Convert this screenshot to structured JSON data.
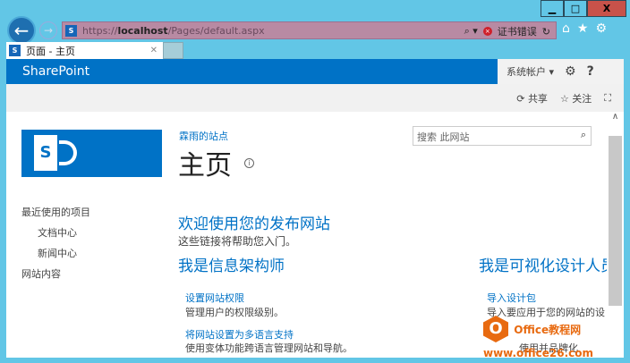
{
  "browser": {
    "url_scheme": "https://",
    "url_host": "localhost",
    "url_path": "/Pages/default.aspx",
    "cert_error": "证书错误",
    "tab_title": "页面 - 主页",
    "window_controls": [
      "minimize",
      "maximize",
      "close"
    ]
  },
  "suite_bar": {
    "brand": "SharePoint",
    "account": "系统帐户",
    "brand_color": "#0072c6"
  },
  "ribbon": {
    "share": "共享",
    "follow": "关注"
  },
  "site": {
    "breadcrumb": "霖雨的站点",
    "title": "主页",
    "search_placeholder": "搜索 此网站"
  },
  "quick_launch": [
    {
      "label": "最近使用的项目",
      "level": 0
    },
    {
      "label": "文档中心",
      "level": 1
    },
    {
      "label": "新闻中心",
      "level": 1
    },
    {
      "label": "网站内容",
      "level": 0
    }
  ],
  "main": {
    "welcome_title": "欢迎使用您的发布网站",
    "welcome_sub": "这些链接将帮助您入门。",
    "col1": {
      "heading": "我是信息架构师",
      "links": [
        {
          "title": "设置网站权限",
          "desc": "管理用户的权限级别。"
        },
        {
          "title": "将网站设置为多语言支持",
          "desc": "使用变体功能跨语言管理网站和导航。"
        }
      ]
    },
    "col2": {
      "heading": "我是可视化设计人员",
      "links": [
        {
          "title": "导入设计包",
          "desc": "导入要应用于您的网站的设"
        },
        {
          "title": "",
          "desc": "使用并品牌化"
        }
      ]
    }
  },
  "watermark": "Office教程网 www.office26.com"
}
